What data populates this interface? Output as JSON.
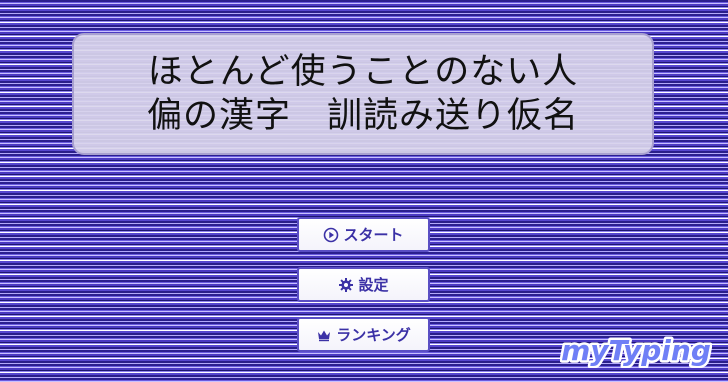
{
  "title": {
    "line1": "ほとんど使うことのない人",
    "line2": "偏の漢字　訓読み送り仮名"
  },
  "menu": {
    "start": {
      "label": "スタート",
      "icon": "play-circle-icon"
    },
    "settings": {
      "label": "設定",
      "icon": "gear-icon"
    },
    "ranking": {
      "label": "ランキング",
      "icon": "crown-icon"
    }
  },
  "logo": {
    "text": "myTyping"
  },
  "colors": {
    "accent": "#3b31a6",
    "button_border": "#5a4ec4",
    "logo_fill": "#6f7ff6",
    "stripe_dark": "#2b1f8f",
    "stripe_light": "#c8c0ff"
  }
}
